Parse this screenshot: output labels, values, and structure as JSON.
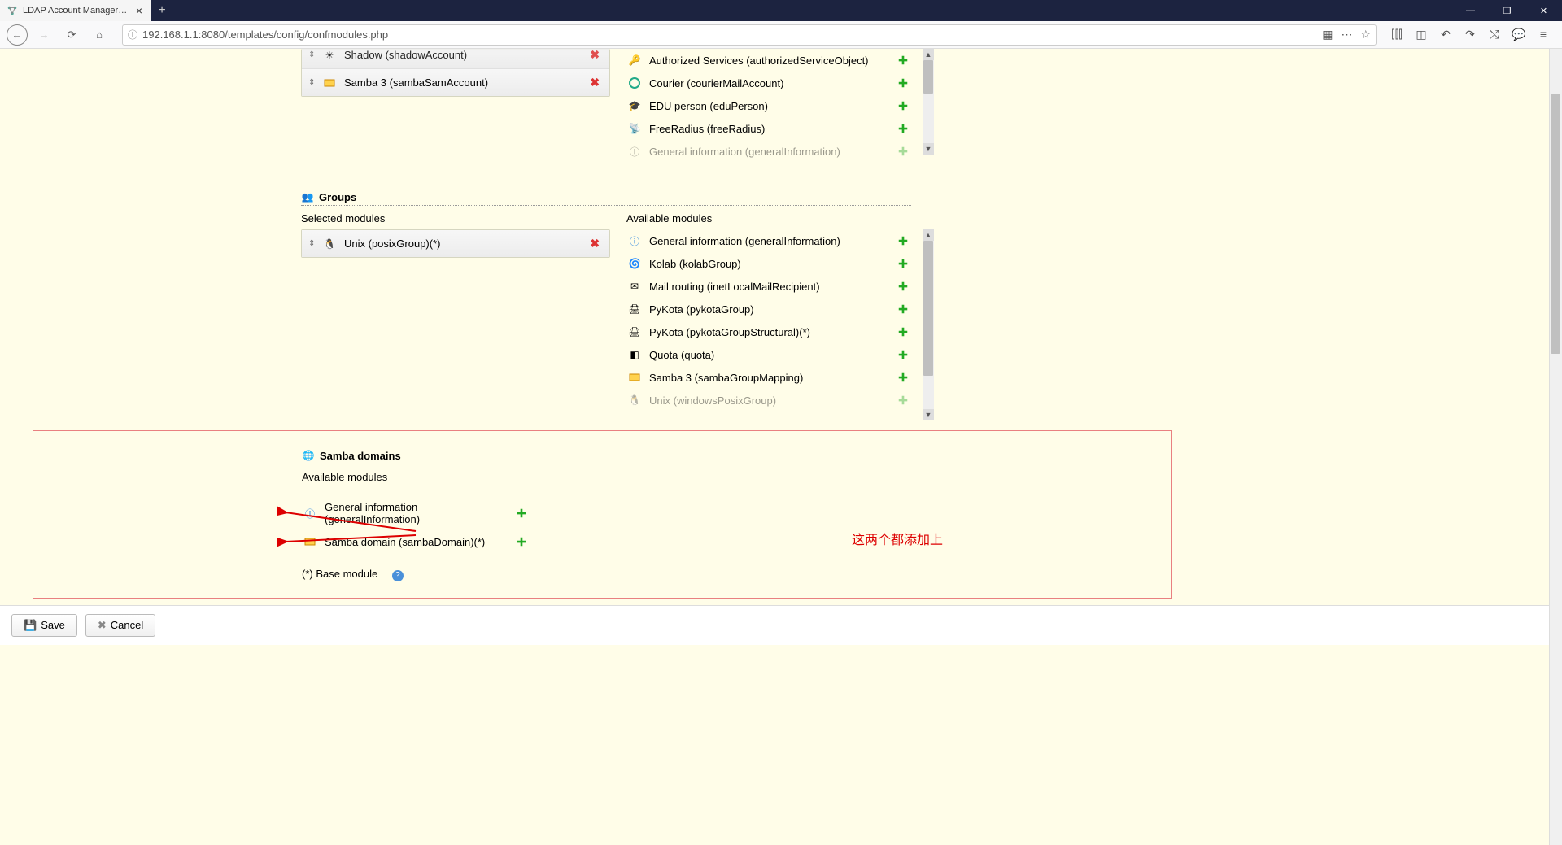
{
  "browser": {
    "tab_title": "LDAP Account Manager Con",
    "url": "192.168.1.1:8080/templates/config/confmodules.php"
  },
  "sections": {
    "users_partial": {
      "selected": [
        {
          "icon": "shadow-icon",
          "label": "Shadow (shadowAccount)"
        },
        {
          "icon": "samba-icon",
          "label": "Samba 3 (sambaSamAccount)"
        }
      ],
      "available": [
        {
          "icon": "key-icon",
          "label": "Authorized Services (authorizedServiceObject)"
        },
        {
          "icon": "courier-icon",
          "label": "Courier (courierMailAccount)"
        },
        {
          "icon": "edu-icon",
          "label": "EDU person (eduPerson)"
        },
        {
          "icon": "radius-icon",
          "label": "FreeRadius (freeRadius)"
        },
        {
          "icon": "info-icon",
          "label": "General information (generalInformation)"
        }
      ]
    },
    "groups": {
      "title": "Groups",
      "selected_header": "Selected modules",
      "available_header": "Available modules",
      "selected": [
        {
          "icon": "linux-icon",
          "label": "Unix (posixGroup)(*)"
        }
      ],
      "available": [
        {
          "icon": "info-icon",
          "label": "General information (generalInformation)"
        },
        {
          "icon": "kolab-icon",
          "label": "Kolab (kolabGroup)"
        },
        {
          "icon": "mail-icon",
          "label": "Mail routing (inetLocalMailRecipient)"
        },
        {
          "icon": "printer-icon",
          "label": "PyKota (pykotaGroup)"
        },
        {
          "icon": "printer-icon",
          "label": "PyKota (pykotaGroupStructural)(*)"
        },
        {
          "icon": "quota-icon",
          "label": "Quota (quota)"
        },
        {
          "icon": "samba-icon",
          "label": "Samba 3 (sambaGroupMapping)"
        },
        {
          "icon": "linux-icon",
          "label": "Unix (windowsPosixGroup)"
        }
      ]
    },
    "samba_domains": {
      "title": "Samba domains",
      "available_header": "Available modules",
      "available": [
        {
          "icon": "info-icon",
          "label": "General information (generalInformation)"
        },
        {
          "icon": "samba-icon",
          "label": "Samba domain (sambaDomain)(*)"
        }
      ],
      "base_note": "(*) Base module"
    }
  },
  "annotation": "这两个都添加上",
  "footer": {
    "save": "Save",
    "cancel": "Cancel"
  }
}
